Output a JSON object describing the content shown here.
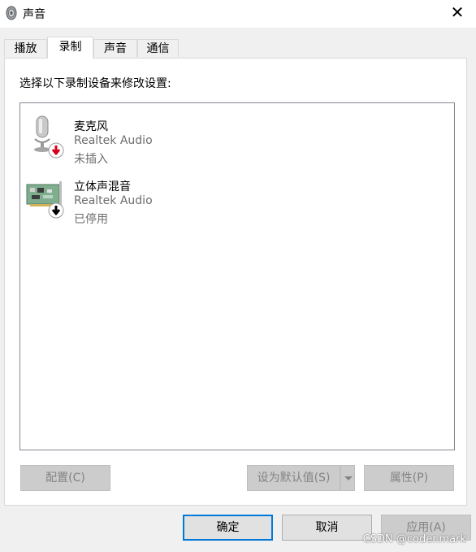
{
  "window": {
    "title": "声音",
    "close_glyph": "✕"
  },
  "tabs": [
    {
      "label": "播放",
      "active": false
    },
    {
      "label": "录制",
      "active": true
    },
    {
      "label": "声音",
      "active": false
    },
    {
      "label": "通信",
      "active": false
    }
  ],
  "instruction": "选择以下录制设备来修改设置:",
  "devices": [
    {
      "name": "麦克风",
      "driver": "Realtek Audio",
      "status": "未插入",
      "icon": "microphone-icon",
      "badge": "unplugged-badge-icon",
      "badge_color": "#d6001c"
    },
    {
      "name": "立体声混音",
      "driver": "Realtek Audio",
      "status": "已停用",
      "icon": "sound-card-icon",
      "badge": "disabled-badge-icon",
      "badge_color": "#000000"
    }
  ],
  "buttons": {
    "configure": "配置(C)",
    "set_default": "设为默认值(S)",
    "properties": "属性(P)",
    "ok": "确定",
    "cancel": "取消",
    "apply": "应用(A)"
  },
  "watermark": "CSDN @coder.mark",
  "colors": {
    "focus_border": "#0078d7",
    "unplugged_red": "#d6001c"
  }
}
